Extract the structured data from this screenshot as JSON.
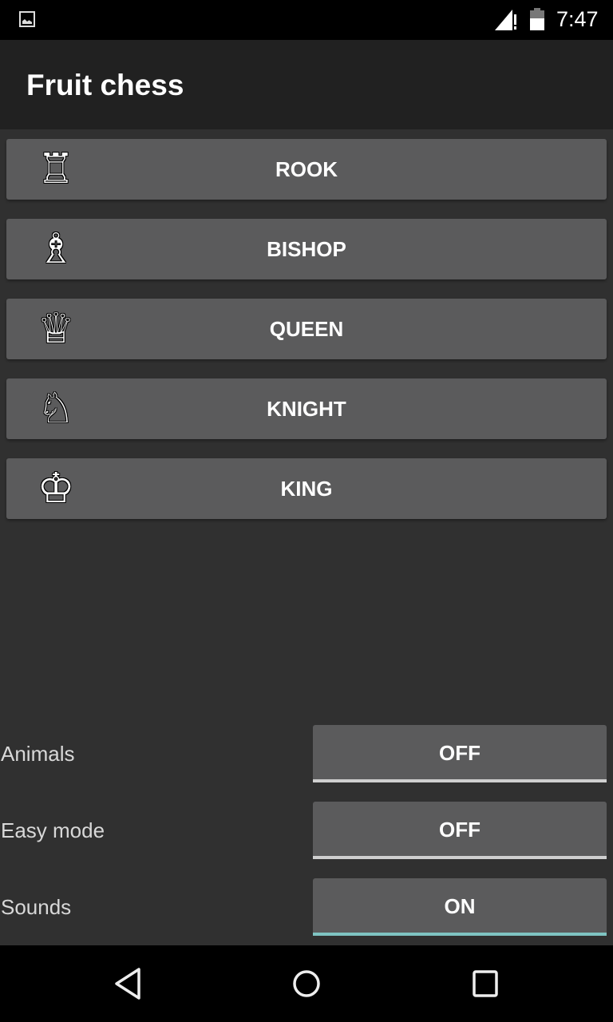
{
  "status_bar": {
    "notification_icon": "image-icon",
    "signal_icon": "signal-no-data-icon",
    "battery_icon": "battery-icon",
    "time": "7:47"
  },
  "app_bar": {
    "title": "Fruit chess"
  },
  "pieces": [
    {
      "label": "ROOK",
      "icon": "rook-icon",
      "glyph": "♖"
    },
    {
      "label": "BISHOP",
      "icon": "bishop-icon",
      "glyph": "♗"
    },
    {
      "label": "QUEEN",
      "icon": "queen-icon",
      "glyph": "♕"
    },
    {
      "label": "KNIGHT",
      "icon": "knight-icon",
      "glyph": "♘"
    },
    {
      "label": "KING",
      "icon": "king-icon",
      "glyph": "♔"
    }
  ],
  "settings": [
    {
      "label": "Animals",
      "value": "OFF",
      "on": false
    },
    {
      "label": "Easy mode",
      "value": "OFF",
      "on": false
    },
    {
      "label": "Sounds",
      "value": "ON",
      "on": true
    }
  ],
  "colors": {
    "toggle_on_indicator": "#7fc4c2",
    "toggle_off_indicator": "#cfcfcf",
    "button_bg": "#5b5b5c"
  },
  "nav_bar": {
    "back": "back-icon",
    "home": "home-icon",
    "recents": "recents-icon"
  }
}
